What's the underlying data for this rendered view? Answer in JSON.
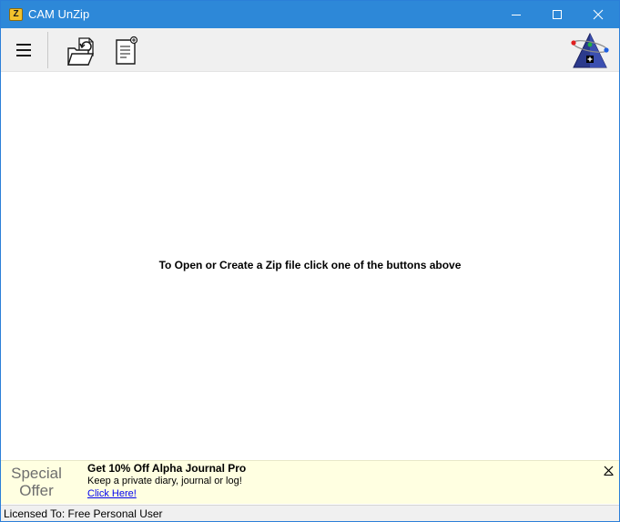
{
  "window": {
    "title": "CAM UnZip",
    "app_icon_letter": "Z"
  },
  "toolbar": {
    "menu_icon": "hamburger-icon",
    "open_icon": "open-folder-icon",
    "new_icon": "new-document-icon",
    "logo_icon": "pyramid-atom-logo"
  },
  "main": {
    "hint": "To Open or Create a Zip file click one of the buttons above"
  },
  "ad": {
    "label_line1": "Special",
    "label_line2": "Offer",
    "title": "Get 10% Off Alpha Journal Pro",
    "description": "Keep a private diary, journal or log!",
    "link": "Click Here!"
  },
  "status": {
    "text": "Licensed To: Free Personal User"
  },
  "colors": {
    "titlebar": "#2d88d8",
    "ad_background": "#ffffe1",
    "link": "#0000ee"
  }
}
